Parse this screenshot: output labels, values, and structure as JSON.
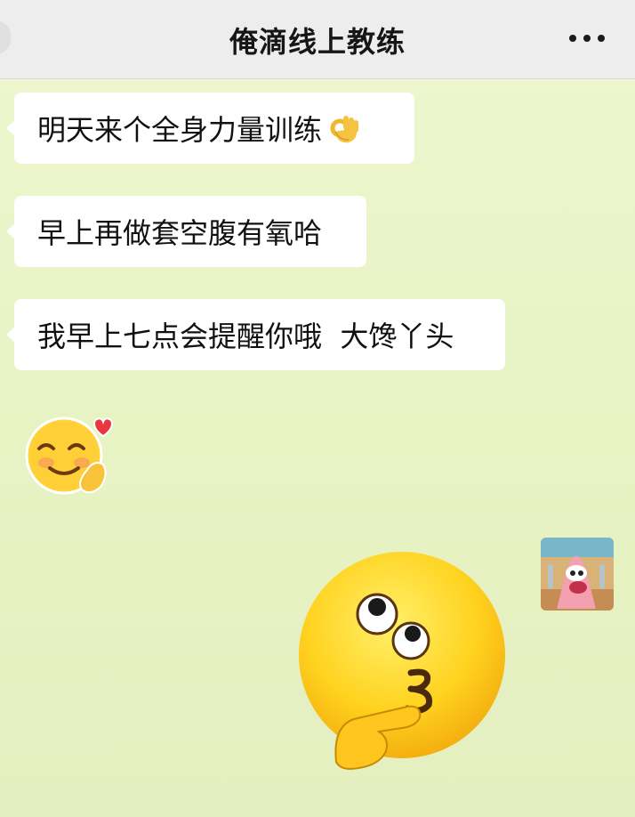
{
  "header": {
    "title": "俺滴线上教练",
    "more_icon": "more-dots-icon"
  },
  "messages": [
    {
      "side": "left",
      "text": "明天来个全身力量训练",
      "trailing_emoji": "ok-hand-emoji"
    },
    {
      "side": "left",
      "text": "早上再做套空腹有氧哈"
    },
    {
      "side": "left",
      "text": "我早上七点会提醒你哦  大馋丫头"
    }
  ],
  "stickers": {
    "received": "shy-smile-heart-emoji",
    "sent": "thinking-kiss-emoji",
    "sender_avatar": "patrick-star-avatar"
  },
  "colors": {
    "header_bg": "#ededed",
    "chat_bg": "#e9f4c6",
    "bubble_bg": "#ffffff",
    "text": "#111111"
  }
}
